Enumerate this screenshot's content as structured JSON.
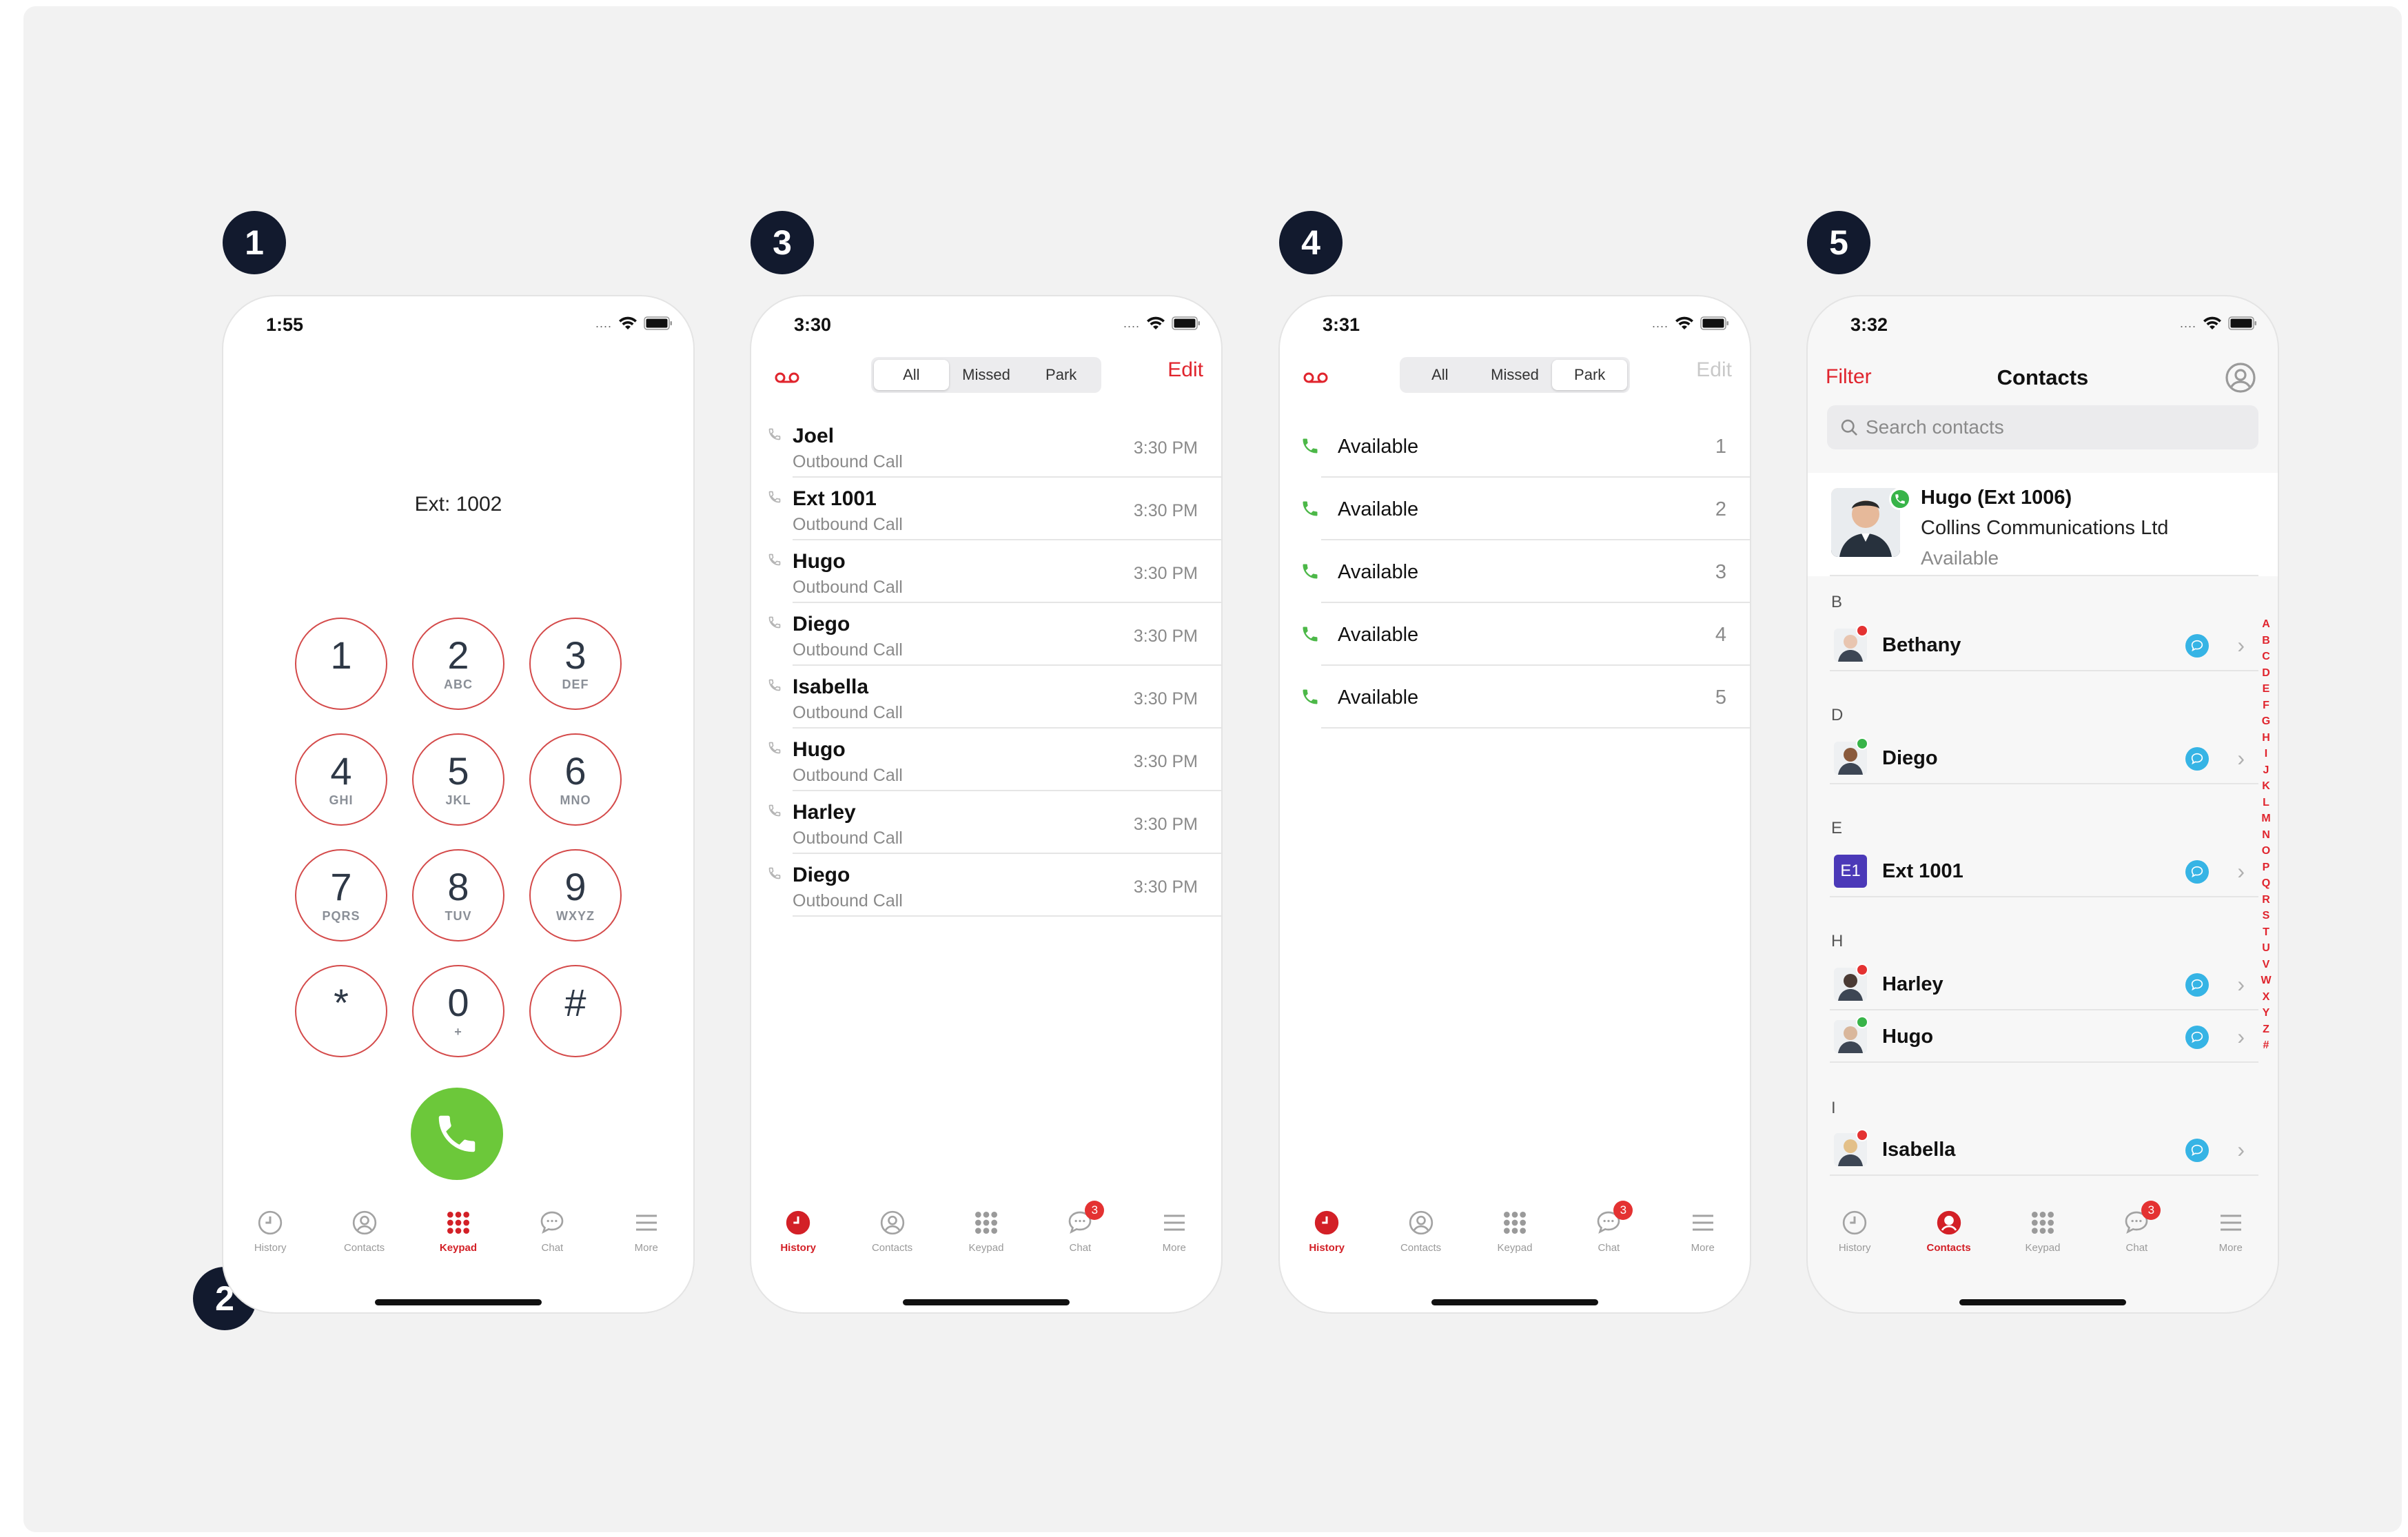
{
  "markers": [
    "1",
    "2",
    "3",
    "4",
    "5"
  ],
  "colors": {
    "accent": "#d32027",
    "call_green": "#6cc83a",
    "presence_green": "#38b449",
    "presence_red": "#e43232",
    "chat_blue": "#36b4e5"
  },
  "tabs": [
    "History",
    "Contacts",
    "Keypad",
    "Chat",
    "More"
  ],
  "chat_badge": "3",
  "keypad_screen": {
    "time": "1:55",
    "extension": "Ext: 1002",
    "keys": [
      {
        "num": "1",
        "letters": ""
      },
      {
        "num": "2",
        "letters": "ABC"
      },
      {
        "num": "3",
        "letters": "DEF"
      },
      {
        "num": "4",
        "letters": "GHI"
      },
      {
        "num": "5",
        "letters": "JKL"
      },
      {
        "num": "6",
        "letters": "MNO"
      },
      {
        "num": "7",
        "letters": "PQRS"
      },
      {
        "num": "8",
        "letters": "TUV"
      },
      {
        "num": "9",
        "letters": "WXYZ"
      },
      {
        "num": "*",
        "letters": ""
      },
      {
        "num": "0",
        "letters": "+"
      },
      {
        "num": "#",
        "letters": ""
      }
    ],
    "active_tab": "Keypad"
  },
  "history_screen": {
    "time": "3:30",
    "segments": [
      "All",
      "Missed",
      "Park"
    ],
    "active_segment": "All",
    "edit_label": "Edit",
    "calls": [
      {
        "name": "Joel",
        "type": "Outbound Call",
        "time": "3:30 PM"
      },
      {
        "name": "Ext 1001",
        "type": "Outbound Call",
        "time": "3:30 PM"
      },
      {
        "name": "Hugo",
        "type": "Outbound Call",
        "time": "3:30 PM"
      },
      {
        "name": "Diego",
        "type": "Outbound Call",
        "time": "3:30 PM"
      },
      {
        "name": "Isabella",
        "type": "Outbound Call",
        "time": "3:30 PM"
      },
      {
        "name": "Hugo",
        "type": "Outbound Call",
        "time": "3:30 PM"
      },
      {
        "name": "Harley",
        "type": "Outbound Call",
        "time": "3:30 PM"
      },
      {
        "name": "Diego",
        "type": "Outbound Call",
        "time": "3:30 PM"
      }
    ],
    "active_tab": "History"
  },
  "park_screen": {
    "time": "3:31",
    "segments": [
      "All",
      "Missed",
      "Park"
    ],
    "active_segment": "Park",
    "edit_label": "Edit",
    "slots": [
      {
        "label": "Available",
        "num": "1"
      },
      {
        "label": "Available",
        "num": "2"
      },
      {
        "label": "Available",
        "num": "3"
      },
      {
        "label": "Available",
        "num": "4"
      },
      {
        "label": "Available",
        "num": "5"
      }
    ],
    "active_tab": "History"
  },
  "contacts_screen": {
    "time": "3:32",
    "filter_label": "Filter",
    "title": "Contacts",
    "search_placeholder": "Search contacts",
    "me": {
      "name": "Hugo (Ext 1006)",
      "company": "Collins Communications Ltd",
      "status": "Available"
    },
    "sections": [
      {
        "letter": "B",
        "contacts": [
          {
            "name": "Bethany",
            "presence": "red"
          }
        ]
      },
      {
        "letter": "D",
        "contacts": [
          {
            "name": "Diego",
            "presence": "green"
          }
        ]
      },
      {
        "letter": "E",
        "contacts": [
          {
            "name": "Ext 1001",
            "presence": "none",
            "initials": "E1"
          }
        ]
      },
      {
        "letter": "H",
        "contacts": [
          {
            "name": "Harley",
            "presence": "red"
          },
          {
            "name": "Hugo",
            "presence": "green"
          }
        ]
      },
      {
        "letter": "I",
        "contacts": [
          {
            "name": "Isabella",
            "presence": "red"
          }
        ]
      }
    ],
    "index_letters": [
      "A",
      "B",
      "C",
      "D",
      "E",
      "F",
      "G",
      "H",
      "I",
      "J",
      "K",
      "L",
      "M",
      "N",
      "O",
      "P",
      "Q",
      "R",
      "S",
      "T",
      "U",
      "V",
      "W",
      "X",
      "Y",
      "Z",
      "#"
    ],
    "active_tab": "Contacts"
  }
}
